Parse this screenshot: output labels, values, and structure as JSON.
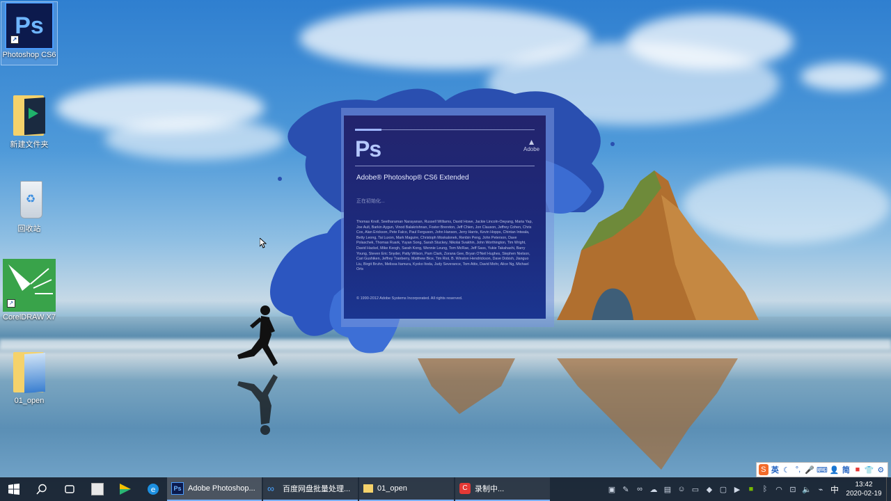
{
  "desktop_icons": [
    {
      "label": "Photoshop CS6",
      "icon": "photoshop-icon"
    },
    {
      "label": "新建文件夹",
      "icon": "folder-icon"
    },
    {
      "label": "回收站",
      "icon": "recycle-bin-icon"
    },
    {
      "label": "CorelDRAW X7",
      "icon": "coreldraw-icon"
    },
    {
      "label": "01_open",
      "icon": "folder-icon"
    }
  ],
  "splash": {
    "logo": "Ps",
    "adobe": "Adobe",
    "product": "Adobe® Photoshop® CS6 Extended",
    "status": "正在初始化...",
    "credits": "Thomas Knoll, Seetharaman Narayanan, Russell Williams, David Howe, Jackie Lincoln-Owyang, Maria Yap, Joe Ault, Barkin Aygun, Vinod Balakrishnan, Foster Brereton, Jeff Chien, Jon Clauson, Jeffrey Cohen, Chris Cox, Alan Erickson, Pete Falco, Paul Ferguson, John Hanson, Jerry Harris, Kevin Hopps, Chintan Intwala, Betty Leong, Tai Luxon, Mark Maguire, Christoph Moskalonek, Renbin Peng, John Peterson, Dave Polaschek, Thomas Ruark, Yuyan Song, Sarah Stuckey, Nikolai Svakhin, John Worthington, Tim Wright, David Hackel, Mike Keogh, Sarah Kong, Wennie Leung, Tom McRae, Jeff Sass, Yukie Takahashi, Barry Young, Steven Eric Snyder, Patty Wilson, Pam Clark, Zorana Gee, Bryan O'Neil Hughes, Stephen Nielson, Cari Gushiken, Jeffrey Tranberry, Matthew Bice, Tim Riot, B. Winston Hendrickson, Dave Dobish, Jianguo Liu, Birgit Bruhn, Melissa Itamura, Kyoko Itoda, Judy Severance, Tom Attix, David Mohr, Alice Ng, Michael Orts",
    "copyright": "© 1990-2012 Adobe Systems Incorporated. All rights reserved."
  },
  "ime": {
    "mode": "英",
    "chinese": "简"
  },
  "taskbar": {
    "apps": [
      {
        "label": "Adobe Photoshop...",
        "icon": "photoshop-icon"
      },
      {
        "label": "百度网盘批量处理...",
        "icon": "baidu-netdisk-icon"
      },
      {
        "label": "01_open",
        "icon": "folder-icon"
      },
      {
        "label": "录制中...",
        "icon": "recorder-icon"
      }
    ],
    "ime_indicator": "中",
    "time": "13:42",
    "date": "2020-02-19"
  }
}
